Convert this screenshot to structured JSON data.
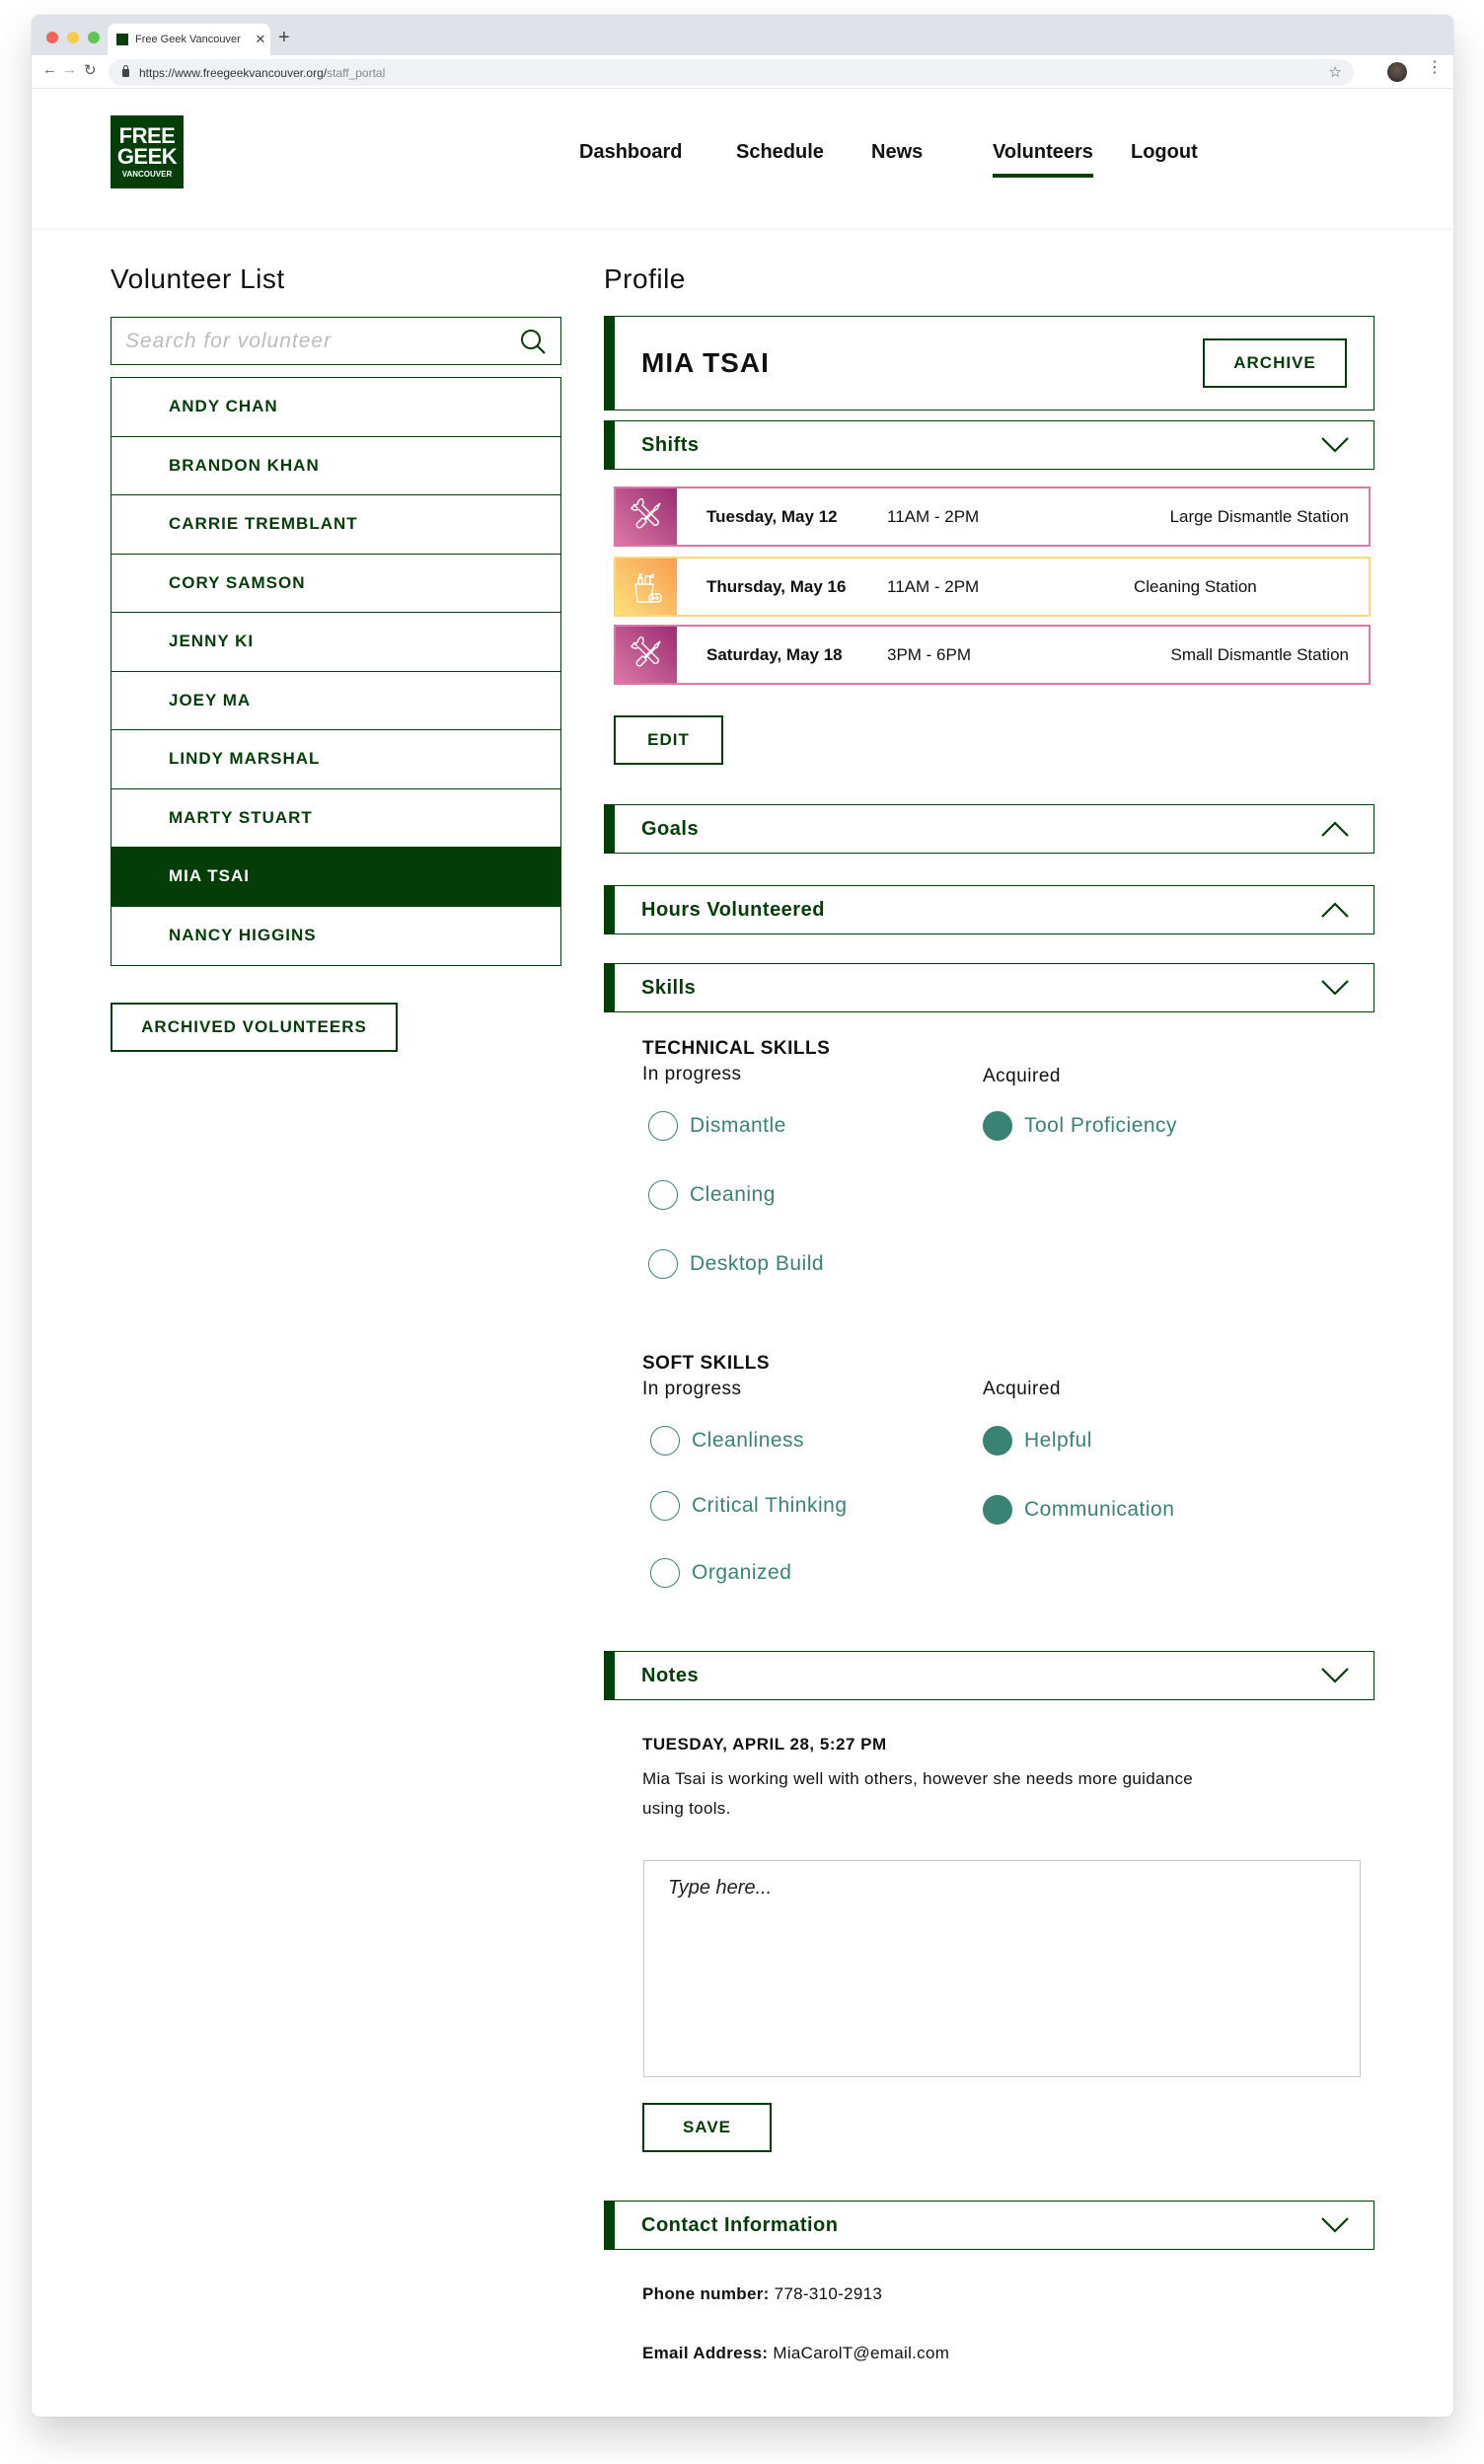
{
  "browser": {
    "tab_title": "Free Geek Vancouver",
    "url_main": "https://www.freegeekvancouver.org/",
    "url_path": "staff_portal"
  },
  "site": {
    "logo": {
      "line1": "FREE",
      "line2": "GEEK",
      "line3": "VANCOUVER"
    },
    "nav": [
      {
        "label": "Dashboard",
        "active": false
      },
      {
        "label": "Schedule",
        "active": false
      },
      {
        "label": "News",
        "active": false
      },
      {
        "label": "Volunteers",
        "active": true
      },
      {
        "label": "Logout",
        "active": false
      }
    ]
  },
  "volunteer_list": {
    "title": "Volunteer List",
    "search_placeholder": "Search for volunteer",
    "items": [
      {
        "name": "ANDY CHAN",
        "selected": false
      },
      {
        "name": "BRANDON KHAN",
        "selected": false
      },
      {
        "name": "CARRIE TREMBLANT",
        "selected": false
      },
      {
        "name": "CORY SAMSON",
        "selected": false
      },
      {
        "name": "JENNY KI",
        "selected": false
      },
      {
        "name": "JOEY MA",
        "selected": false
      },
      {
        "name": "LINDY MARSHAL",
        "selected": false
      },
      {
        "name": "MARTY STUART",
        "selected": false
      },
      {
        "name": "MIA TSAI",
        "selected": true
      },
      {
        "name": "NANCY HIGGINS",
        "selected": false
      }
    ],
    "archived_button": "ARCHIVED VOLUNTEERS"
  },
  "profile": {
    "title": "Profile",
    "name": "MIA TSAI",
    "archive_button": "ARCHIVE",
    "sections": {
      "shifts": {
        "title": "Shifts",
        "expanded": true
      },
      "goals": {
        "title": "Goals",
        "expanded": false
      },
      "hours": {
        "title": "Hours Volunteered",
        "expanded": false
      },
      "skills": {
        "title": "Skills",
        "expanded": true
      },
      "notes": {
        "title": "Notes",
        "expanded": true
      },
      "contact": {
        "title": "Contact Information",
        "expanded": true
      }
    },
    "shifts": [
      {
        "date": "Tuesday, May 12",
        "time": "11AM - 2PM",
        "station": "Large Dismantle Station",
        "icon": "tools-icon",
        "color": "#c24f8c"
      },
      {
        "date": "Thursday, May 16",
        "time": "11AM - 2PM",
        "station": "Cleaning Station",
        "icon": "cleaning-supplies-icon",
        "color": "#f9b35f"
      },
      {
        "date": "Saturday, May 18",
        "time": "3PM - 6PM",
        "station": "Small Dismantle Station",
        "icon": "tools-icon",
        "color": "#c24f8c"
      }
    ],
    "edit_button": "EDIT",
    "skills": {
      "in_progress_label": "In progress",
      "acquired_label": "Acquired",
      "technical": {
        "heading": "TECHNICAL SKILLS",
        "in_progress": [
          "Dismantle",
          "Cleaning",
          "Desktop Build"
        ],
        "acquired": [
          "Tool Proficiency"
        ]
      },
      "soft": {
        "heading": "SOFT SKILLS",
        "in_progress": [
          "Cleanliness",
          "Critical Thinking",
          "Organized"
        ],
        "acquired": [
          "Helpful",
          "Communication"
        ]
      }
    },
    "notes": {
      "entries": [
        {
          "date": "TUESDAY, APRIL 28, 5:27 PM",
          "text": "Mia Tsai is working well with others, however she needs more guidance using tools."
        }
      ],
      "input_placeholder": "Type here...",
      "save_button": "SAVE"
    },
    "contact": {
      "phone_label": "Phone number:",
      "phone": "778-310-2913",
      "email_label": "Email Address:",
      "email": "MiaCarolT@email.com"
    }
  },
  "colors": {
    "brand_green": "#033d08",
    "skill_teal": "#3a8274",
    "dismantle_pink": "#d979a8",
    "cleaning_yellow": "#f9d77a"
  }
}
